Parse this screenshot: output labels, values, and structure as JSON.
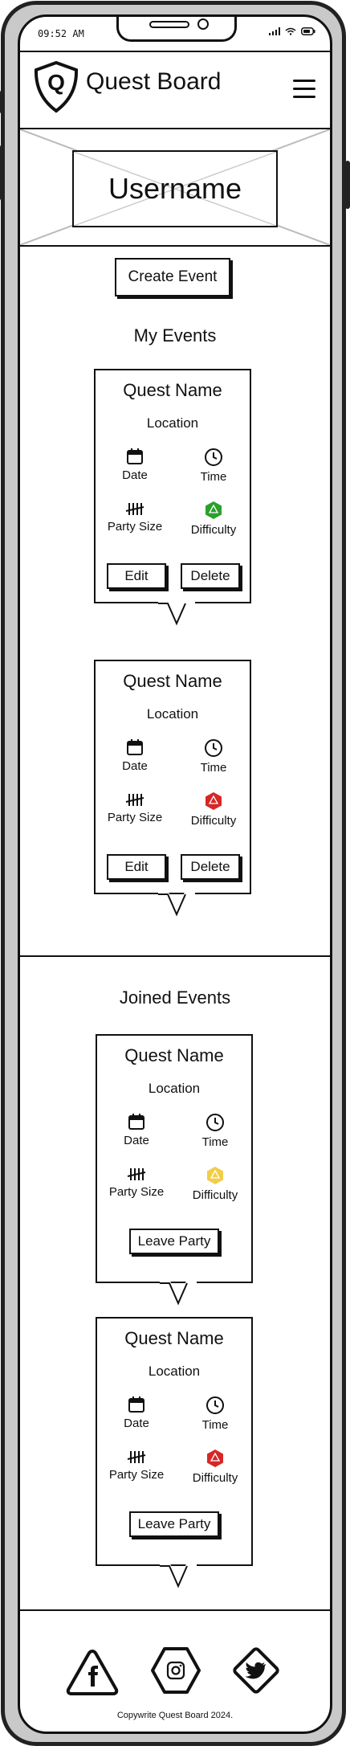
{
  "status_bar": {
    "time": "09:52 AM"
  },
  "header": {
    "logo_letter": "Q",
    "title": "Quest Board"
  },
  "profile": {
    "username": "Username"
  },
  "actions": {
    "create_event": "Create Event"
  },
  "my_events": {
    "title": "My Events",
    "cards": [
      {
        "quest_name": "Quest Name",
        "location": "Location",
        "date_label": "Date",
        "time_label": "Time",
        "party_label": "Party Size",
        "difficulty_label": "Difficulty",
        "difficulty_color": "#2ca02c",
        "edit_label": "Edit",
        "delete_label": "Delete"
      },
      {
        "quest_name": "Quest Name",
        "location": "Location",
        "date_label": "Date",
        "time_label": "Time",
        "party_label": "Party Size",
        "difficulty_label": "Difficulty",
        "difficulty_color": "#d62728",
        "edit_label": "Edit",
        "delete_label": "Delete"
      }
    ]
  },
  "joined_events": {
    "title": "Joined Events",
    "cards": [
      {
        "quest_name": "Quest Name",
        "location": "Location",
        "date_label": "Date",
        "time_label": "Time",
        "party_label": "Party Size",
        "difficulty_label": "Difficulty",
        "difficulty_color": "#f2cd4a",
        "leave_label": "Leave Party"
      },
      {
        "quest_name": "Quest Name",
        "location": "Location",
        "date_label": "Date",
        "time_label": "Time",
        "party_label": "Party Size",
        "difficulty_label": "Difficulty",
        "difficulty_color": "#d62728",
        "leave_label": "Leave Party"
      }
    ]
  },
  "footer": {
    "social": [
      "facebook-icon",
      "instagram-icon",
      "twitter-icon"
    ],
    "copyright": "Copywrite Quest Board 2024."
  }
}
